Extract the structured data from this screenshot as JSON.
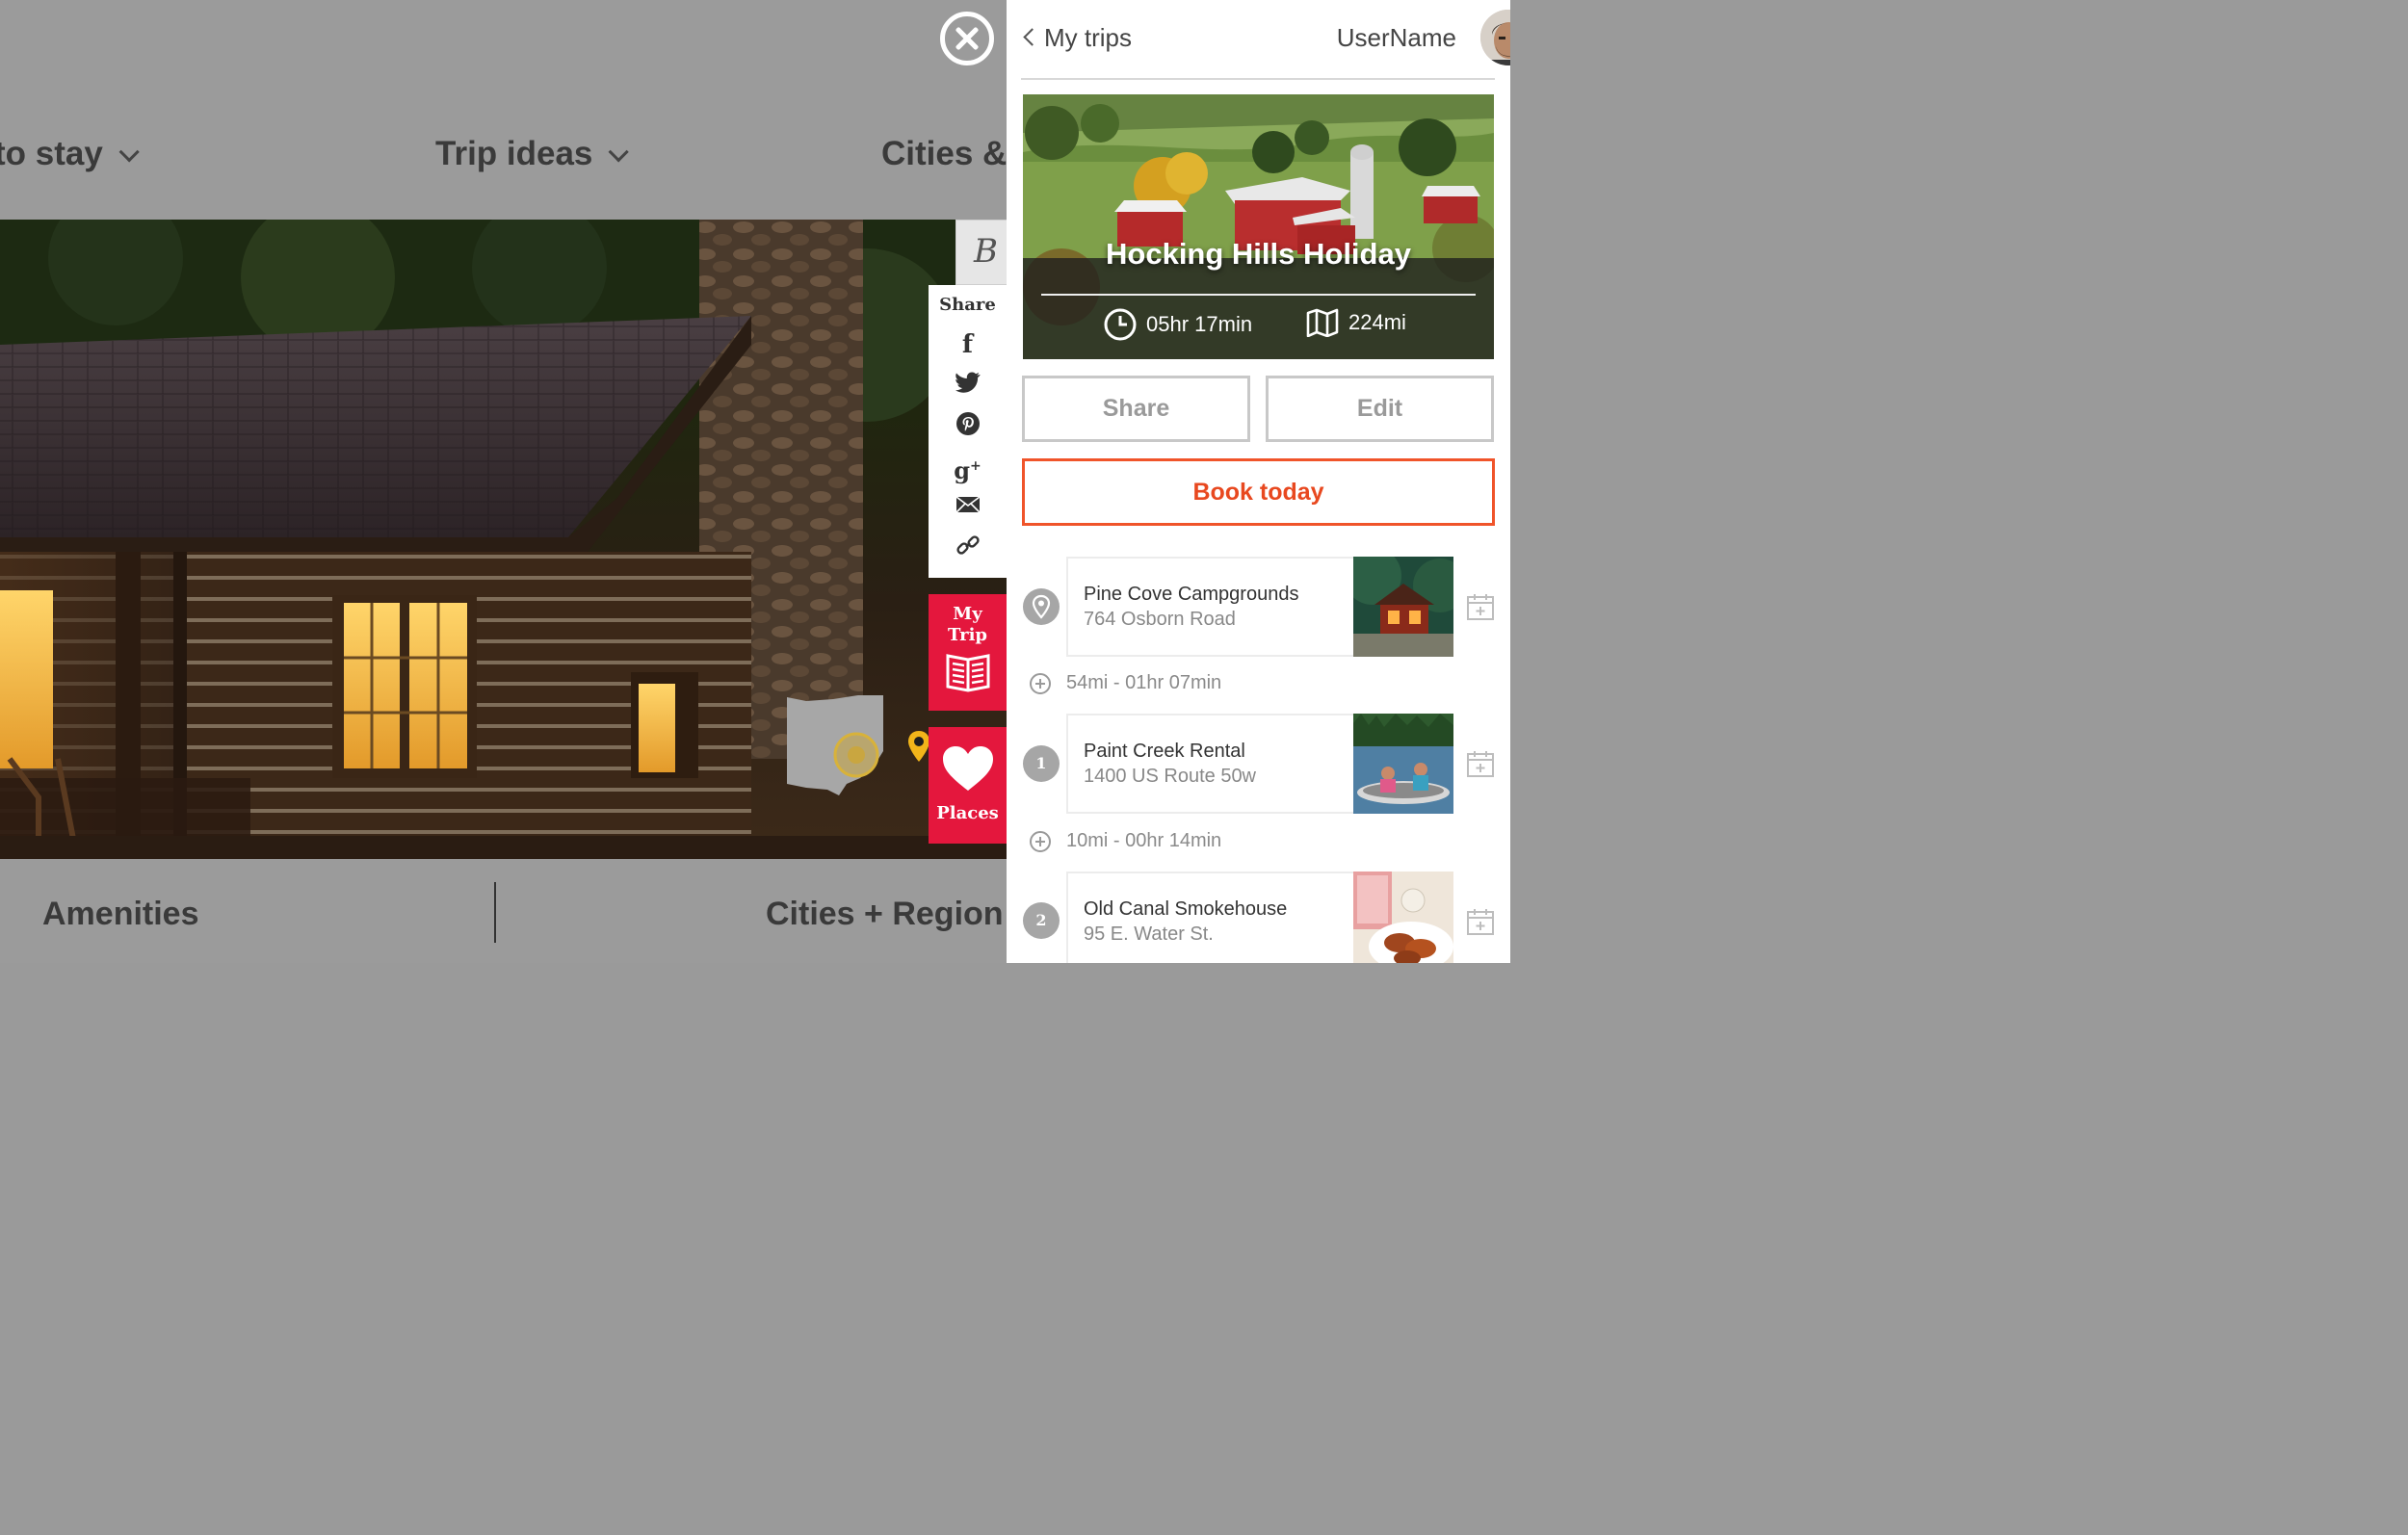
{
  "top_nav": {
    "items": [
      {
        "label": "to stay"
      },
      {
        "label": "Trip ideas"
      },
      {
        "label": "Cities &"
      }
    ]
  },
  "share_bar": {
    "title": "Share",
    "icons": [
      "facebook-icon",
      "twitter-icon",
      "pinterest-icon",
      "google-plus-icon",
      "email-icon",
      "link-icon"
    ]
  },
  "side_buttons": {
    "my_trip_label_line1": "My",
    "my_trip_label_line2": "Trip",
    "places_label": "Places"
  },
  "bottom_nav": {
    "left": "Amenities",
    "right": "Cities + Region"
  },
  "panel": {
    "back_label": "My trips",
    "username": "UserName",
    "trip": {
      "title": "Hocking Hills Holiday",
      "duration": "05hr 17min",
      "distance": "224mi"
    },
    "share_label": "Share",
    "edit_label": "Edit",
    "book_label": "Book today",
    "stops": [
      {
        "marker": "",
        "name": "Pine Cove Campgrounds",
        "address": "764 Osborn Road"
      },
      {
        "marker": "1",
        "name": "Paint Creek Rental",
        "address": "1400 US Route 50w"
      },
      {
        "marker": "2",
        "name": "Old Canal Smokehouse",
        "address": "95 E. Water St."
      }
    ],
    "legs": [
      {
        "text": "54mi - 01hr 07min"
      },
      {
        "text": "10mi - 00hr 14min"
      }
    ]
  },
  "colors": {
    "accent_red": "#e4173d",
    "book_orange": "#f0542a",
    "overlay_gray": "#9b9b9b"
  }
}
